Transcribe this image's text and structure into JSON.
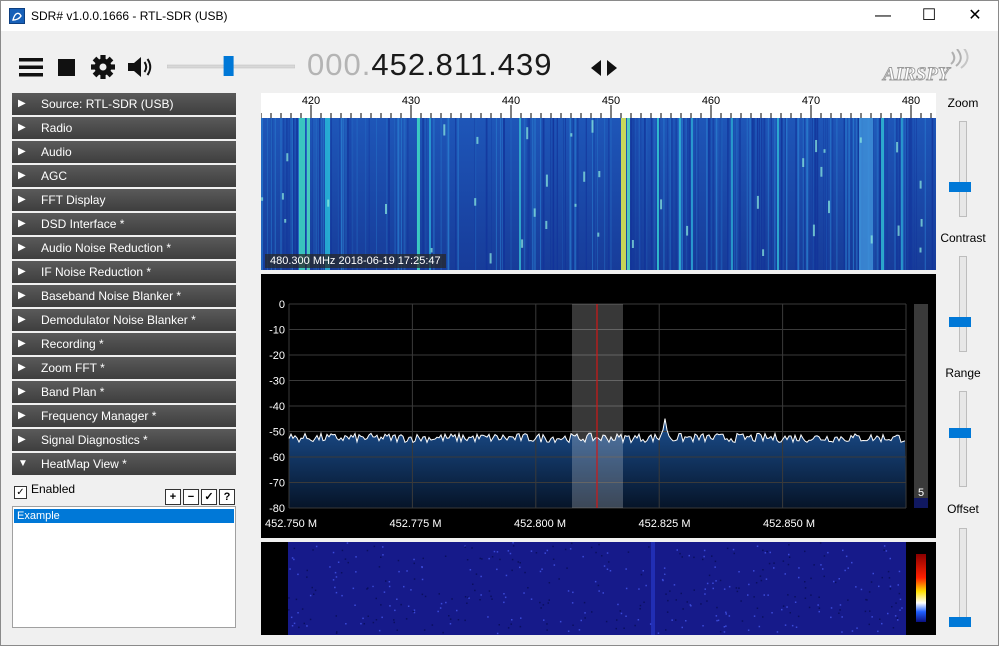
{
  "window": {
    "title": "SDR# v1.0.0.1666 - RTL-SDR (USB)",
    "minimize_glyph": "—",
    "maximize_glyph": "☐",
    "close_glyph": "✕"
  },
  "toolbar": {
    "icons": [
      "menu-icon",
      "stop-icon",
      "gear-icon",
      "speaker-icon"
    ],
    "volume_level": 0.48,
    "frequency_dim": "000.",
    "frequency_main": "452.811.439",
    "logo_text": "AIRSPY"
  },
  "sidebar": {
    "panels": [
      {
        "label": "Source: RTL-SDR (USB)",
        "arrow": "▶"
      },
      {
        "label": "Radio",
        "arrow": "▶"
      },
      {
        "label": "Audio",
        "arrow": "▶"
      },
      {
        "label": "AGC",
        "arrow": "▶"
      },
      {
        "label": "FFT Display",
        "arrow": "▶"
      },
      {
        "label": "DSD Interface *",
        "arrow": "▶"
      },
      {
        "label": "Audio Noise Reduction *",
        "arrow": "▶"
      },
      {
        "label": "IF Noise Reduction *",
        "arrow": "▶"
      },
      {
        "label": "Baseband Noise Blanker *",
        "arrow": "▶"
      },
      {
        "label": "Demodulator Noise Blanker *",
        "arrow": "▶"
      },
      {
        "label": "Recording *",
        "arrow": "▶"
      },
      {
        "label": "Zoom FFT *",
        "arrow": "▶"
      },
      {
        "label": "Band Plan *",
        "arrow": "▶"
      },
      {
        "label": "Frequency Manager *",
        "arrow": "▶"
      },
      {
        "label": "Signal Diagnostics *",
        "arrow": "▶"
      },
      {
        "label": "HeatMap View *",
        "arrow": "▼"
      }
    ],
    "heatmap": {
      "enabled_label": "Enabled",
      "enabled_checked": "✓",
      "buttons": [
        "+",
        "−",
        "✓",
        "?"
      ],
      "list_items": [
        "Example"
      ]
    }
  },
  "waterfall": {
    "ruler_ticks": [
      "420",
      "430",
      "440",
      "450",
      "460",
      "470",
      "480"
    ],
    "timestamp": "480.300 MHz   2018-06-19   17:25:47"
  },
  "spectrum": {
    "y_ticks": [
      "0",
      "-10",
      "-20",
      "-30",
      "-40",
      "-50",
      "-60",
      "-70",
      "-80"
    ],
    "x_ticks": [
      "452.750 M",
      "452.775 M",
      "452.800 M",
      "452.825 M",
      "452.850 M"
    ],
    "level_value": "5",
    "colors": {
      "trace": "#ffffff",
      "fill": "#0e3a6e",
      "marker": "#d01818",
      "grid": "#3a3a3a"
    }
  },
  "right_panel": {
    "zoom_label": "Zoom",
    "contrast_label": "Contrast",
    "range_label": "Range",
    "offset_label": "Offset",
    "zoom_level": 0.3,
    "contrast_level": 0.3,
    "range_level": 0.55,
    "offset_level": 0.0
  }
}
